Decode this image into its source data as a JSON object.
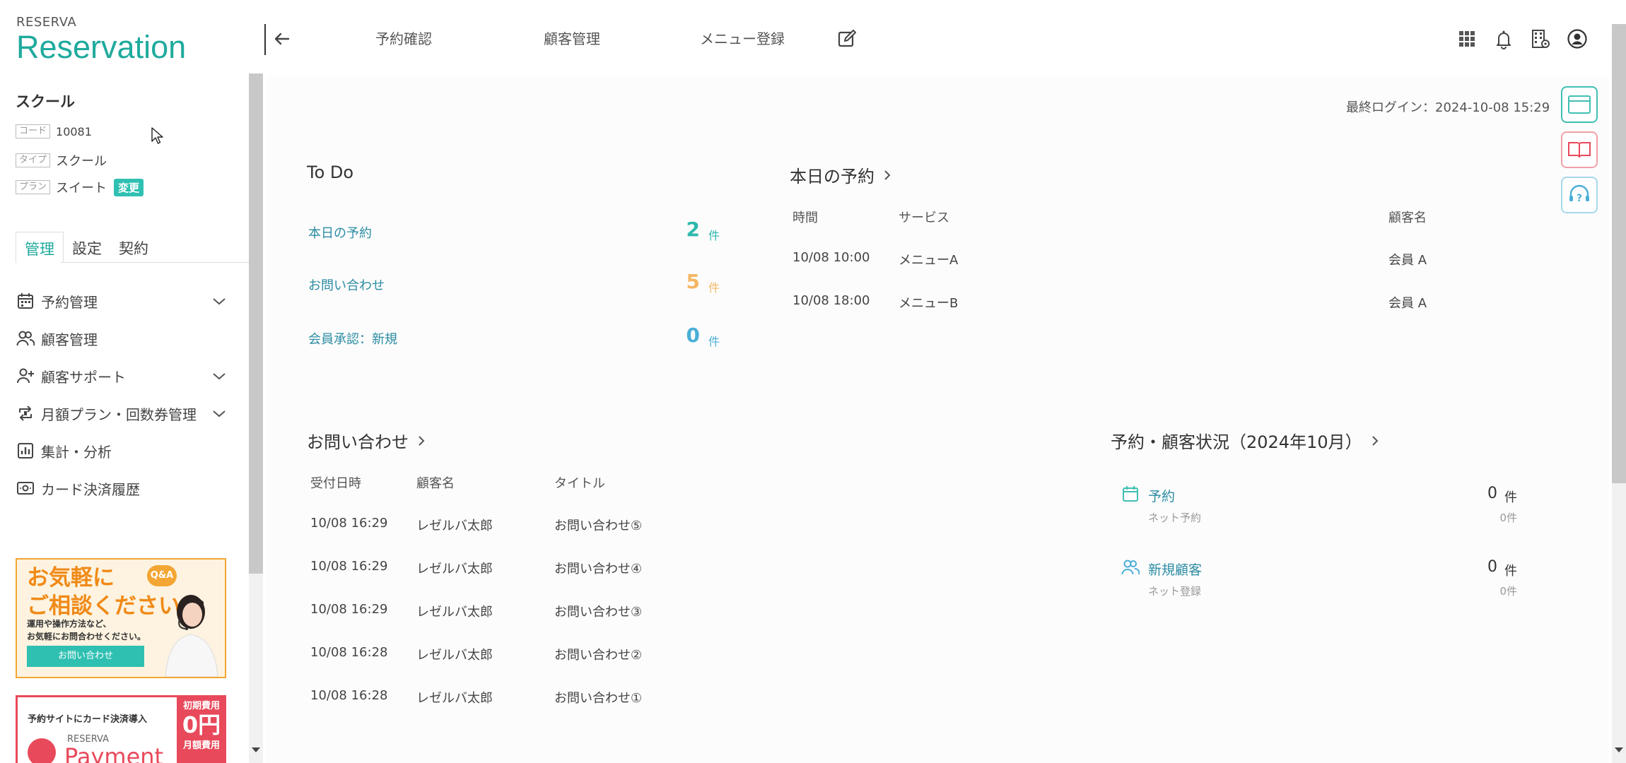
{
  "header": {
    "logo_small": "RESERVA",
    "logo_big": "Reservation",
    "nav": [
      "予約確認",
      "顧客管理",
      "メニュー登録"
    ],
    "icons": [
      "apps-grid-icon",
      "bell-icon",
      "building-settings-icon",
      "user-circle-icon"
    ]
  },
  "sidebar": {
    "shop_name": "スクール",
    "code_tag": "コード",
    "code_value": "10081",
    "type_tag": "タイプ",
    "type_value": "スクール",
    "plan_tag": "プラン",
    "plan_value": "スイート",
    "change_label": "変更",
    "tabs": [
      "管理",
      "設定",
      "契約"
    ],
    "menu": [
      {
        "label": "予約管理",
        "icon": "calendar-icon",
        "expandable": true
      },
      {
        "label": "顧客管理",
        "icon": "users-icon",
        "expandable": false
      },
      {
        "label": "顧客サポート",
        "icon": "user-plus-icon",
        "expandable": true
      },
      {
        "label": "月額プラン・回数券管理",
        "icon": "repeat-icon",
        "expandable": true
      },
      {
        "label": "集計・分析",
        "icon": "chart-icon",
        "expandable": false
      },
      {
        "label": "カード決済履歴",
        "icon": "card-icon",
        "expandable": false
      }
    ],
    "banner1": {
      "line1": "お気軽に",
      "line2": "ご相談ください。",
      "qa": "Q&A",
      "desc1": "運用や操作方法など、",
      "desc2": "お気軽にお問合わせください。",
      "button": "お問い合わせ"
    },
    "banner2": {
      "title": "予約サイトにカード決済導入",
      "initial_fee_label": "初期費用",
      "initial_fee": "0円",
      "monthly_fee_label": "月額費用",
      "logo_small": "RESERVA",
      "logo_big": "Payment"
    }
  },
  "main": {
    "last_login": "最終ログイン：2024-10-08 15:29",
    "todo": {
      "title": "To Do",
      "unit": "件",
      "rows": [
        {
          "label": "本日の予約",
          "count": "2",
          "color": "#2fb8ad"
        },
        {
          "label": "お問い合わせ",
          "count": "5",
          "color": "#f5b763"
        },
        {
          "label": "会員承認：新規",
          "count": "0",
          "color": "#4aaed6"
        }
      ]
    },
    "today": {
      "title": "本日の予約",
      "headers": [
        "時間",
        "サービス",
        "顧客名"
      ],
      "rows": [
        [
          "10/08 10:00",
          "メニューA",
          "会員 A"
        ],
        [
          "10/08 18:00",
          "メニューB",
          "会員 A"
        ]
      ]
    },
    "inquiries": {
      "title": "お問い合わせ",
      "headers": [
        "受付日時",
        "顧客名",
        "タイトル"
      ],
      "rows": [
        [
          "10/08 16:29",
          "レゼルバ太郎",
          "お問い合わせ⑤"
        ],
        [
          "10/08 16:29",
          "レゼルバ太郎",
          "お問い合わせ④"
        ],
        [
          "10/08 16:29",
          "レゼルバ太郎",
          "お問い合わせ③"
        ],
        [
          "10/08 16:28",
          "レゼルバ太郎",
          "お問い合わせ②"
        ],
        [
          "10/08 16:28",
          "レゼルバ太郎",
          "お問い合わせ①"
        ]
      ]
    },
    "status": {
      "title": "予約・顧客状況（2024年10月）",
      "unit": "件",
      "rows": [
        {
          "label": "予約",
          "sub": "ネット予約",
          "count": "0",
          "subcount": "0件",
          "icon": "calendar-icon"
        },
        {
          "label": "新規顧客",
          "sub": "ネット登録",
          "count": "0",
          "subcount": "0件",
          "icon": "users-icon"
        }
      ]
    },
    "side_buttons": [
      {
        "icon": "browser-window-icon",
        "color": "#3fbfb3"
      },
      {
        "icon": "book-icon",
        "color": "#e8495b"
      },
      {
        "icon": "support-headset-icon",
        "color": "#4aaed6"
      }
    ]
  }
}
